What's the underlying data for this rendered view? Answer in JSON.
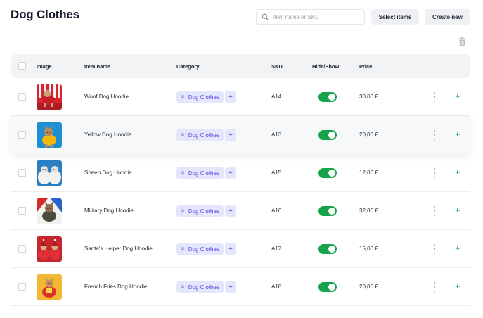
{
  "page": {
    "title": "Dog Clothes"
  },
  "toolbar": {
    "search_placeholder": "Item name or SKU",
    "select_label": "Select items",
    "create_label": "Create new"
  },
  "table": {
    "columns": {
      "image": "Image",
      "name": "Item name",
      "category": "Category",
      "sku": "SKU",
      "visibility": "Hide/Show",
      "price": "Price"
    },
    "rows": [
      {
        "name": "Woof Dog Hoodie",
        "category": "Dog Clothes",
        "sku": "A14",
        "price": "30,00 £",
        "visible": true,
        "image": "dog-red-hoodie-striped-bg"
      },
      {
        "name": "Yellow Dog Hoodie",
        "category": "Dog Clothes",
        "sku": "A13",
        "price": "20,00 £",
        "visible": true,
        "image": "dog-yellow-hoodie-blue-bg"
      },
      {
        "name": "Sheep Dog Hoodie",
        "category": "Dog Clothes",
        "sku": "A15",
        "price": "12,00 £",
        "visible": true,
        "image": "two-dogs-sheep-hoodies-blue-bg"
      },
      {
        "name": "Military Dog Hoodie",
        "category": "Dog Clothes",
        "sku": "A16",
        "price": "32,00 £",
        "visible": true,
        "image": "dog-military-hoodie-red-blue-bg"
      },
      {
        "name": "Santa's Helper Dog Hoodie",
        "category": "Dog Clothes",
        "sku": "A17",
        "price": "15,00 £",
        "visible": true,
        "image": "dogs-santa-hoodie-red-bg"
      },
      {
        "name": "French Fries Dog Hoodie",
        "category": "Dog Clothes",
        "sku": "A18",
        "price": "20,00 £",
        "visible": true,
        "image": "dog-fries-hoodie-yellow-bg"
      }
    ]
  },
  "icons": {
    "search": "search-icon",
    "trash": "trash-icon",
    "more": "more-vertical-icon",
    "add": "plus-icon",
    "remove": "close-icon"
  },
  "colors": {
    "accent_green": "#16a34a",
    "chip_bg": "#e4e6fb",
    "chip_text": "#4f46e5",
    "header_bg": "#f1f3f5"
  }
}
